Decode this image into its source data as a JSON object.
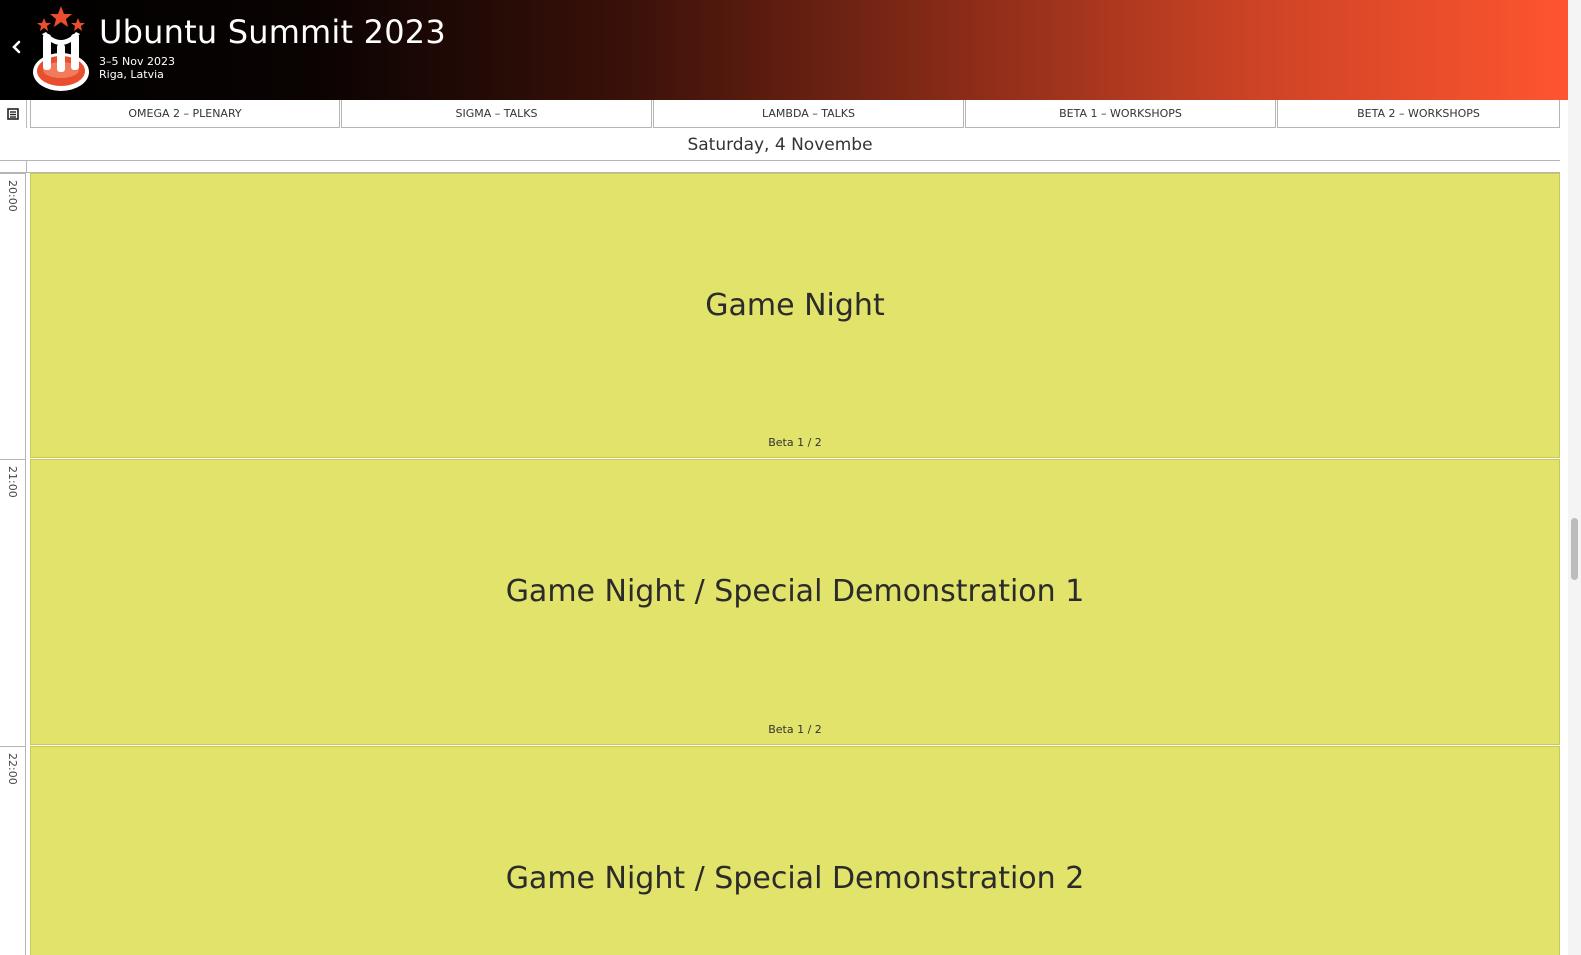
{
  "header": {
    "title": "Ubuntu Summit 2023",
    "dates": "3–5 Nov 2023",
    "location": "Riga, Latvia",
    "back_icon": "chevron-left-icon",
    "logo_icon": "ubuntu-summit-logo"
  },
  "rooms": [
    {
      "label": "OMEGA 2 – PLENARY"
    },
    {
      "label": "SIGMA – TALKS"
    },
    {
      "label": "LAMBDA – TALKS"
    },
    {
      "label": "BETA 1 – WORKSHOPS"
    },
    {
      "label": "BETA 2 – WORKSHOPS"
    }
  ],
  "day_label": "Saturday, 4 Novembe",
  "times": [
    "20:00",
    "21:00",
    "22:00"
  ],
  "events": [
    {
      "title": "Game Night",
      "room": "Beta 1 / 2"
    },
    {
      "title": "Game Night / Special Demonstration 1",
      "room": "Beta 1 / 2"
    },
    {
      "title": "Game Night / Special Demonstration 2",
      "room": ""
    }
  ],
  "colors": {
    "event_bg": "#e2e36a",
    "header_gradient_start": "#000000",
    "header_gradient_end": "#fe5530"
  }
}
